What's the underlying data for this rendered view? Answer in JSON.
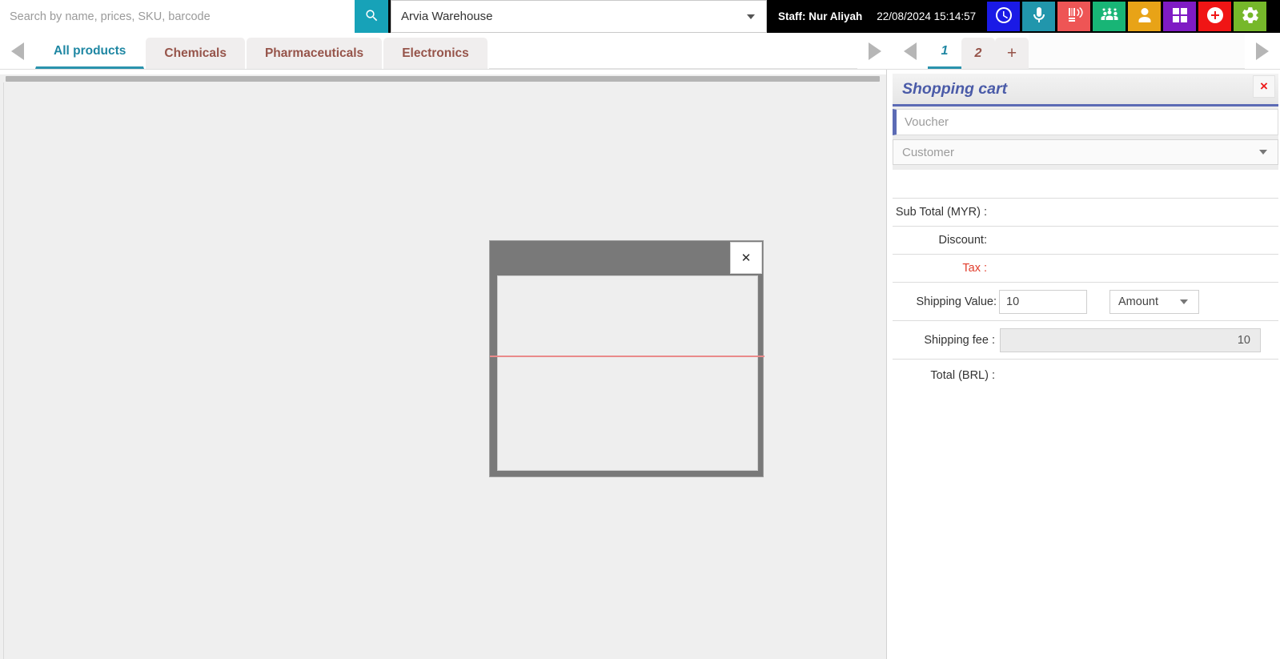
{
  "topbar": {
    "search": {
      "placeholder": "Search by name, prices, SKU, barcode",
      "value": "",
      "icon": "search-icon"
    },
    "warehouse": {
      "selected": "Arvia Warehouse",
      "icon": "chevron-down-icon"
    },
    "staff_label": "Staff: Nur Aliyah",
    "datetime": "22/08/2024 15:14:57",
    "icons": [
      {
        "name": "clock-icon",
        "color": "#1a1ae6",
        "title": "clock"
      },
      {
        "name": "microphone-icon",
        "color": "#2196ac",
        "title": "microphone"
      },
      {
        "name": "barcode-scanner-icon",
        "color": "#ee5555",
        "title": "barcode scanner"
      },
      {
        "name": "staff-group-icon",
        "color": "#18b576",
        "title": "staff"
      },
      {
        "name": "customer-icon",
        "color": "#e8a317",
        "title": "customer"
      },
      {
        "name": "calculator-icon",
        "color": "#7f1bc4",
        "title": "calculator"
      },
      {
        "name": "add-circle-icon",
        "color": "#f01515",
        "title": "add"
      },
      {
        "name": "settings-gear-icon",
        "color": "#76b82a",
        "title": "settings"
      }
    ]
  },
  "tabbar": {
    "prev_arrow": "prev-arrow-icon",
    "next_arrow": "next-arrow-icon",
    "tabs": [
      {
        "label": "All products",
        "active": true
      },
      {
        "label": "Chemicals",
        "active": false
      },
      {
        "label": "Pharmaceuticals",
        "active": false
      },
      {
        "label": "Electronics",
        "active": false
      }
    ],
    "pager": {
      "forward_icon": "pager-forward-icon",
      "back_icon": "pager-back-icon",
      "pages": [
        {
          "label": "1",
          "active": true
        },
        {
          "label": "2",
          "active": false
        }
      ],
      "add_label": "+"
    },
    "far_right_arrow": "far-right-arrow-icon"
  },
  "modal": {
    "close_label": "✕",
    "title": ""
  },
  "cart": {
    "title": "Shopping cart",
    "close_label": "×",
    "voucher": {
      "placeholder": "Voucher",
      "value": ""
    },
    "customer": {
      "placeholder": "Customer",
      "value": "",
      "icon": "chevron-down-icon"
    },
    "summary": [
      {
        "label": "Sub Total (MYR) :",
        "value": "",
        "accent": "normal"
      },
      {
        "label": "Discount:",
        "value": "",
        "accent": "normal"
      },
      {
        "label": "Tax :",
        "value": "",
        "accent": "tax"
      }
    ],
    "shipping": {
      "label": "Shipping Value:",
      "value": "10",
      "type_selected": "Amount"
    },
    "shipping_fee": {
      "label": "Shipping fee :",
      "value": "10"
    },
    "total": {
      "label": "Total (BRL) :",
      "value": ""
    }
  },
  "colors": {
    "accent_teal": "#17a2b8",
    "accent_blue": "#1f87a3",
    "tab_text": "#96544a",
    "cart_title": "#4a5ba8",
    "cart_underline": "#5c6bb5",
    "tax_red": "#e13c2b",
    "close_red": "#ee1c1c",
    "modal_frame": "#797979",
    "modal_line": "#e98a8a"
  }
}
